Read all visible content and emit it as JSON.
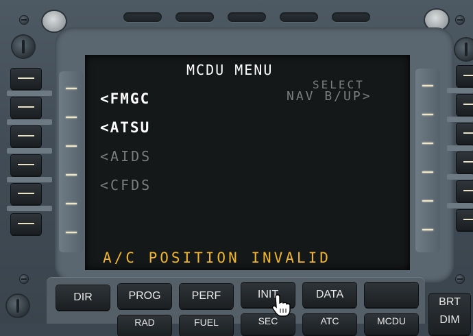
{
  "mcdu": {
    "title": "MCDU MENU",
    "right_label_1": "SELECT",
    "right_value_1": "NAV B/UP>",
    "left_items": [
      {
        "label": "<FMGC",
        "active": true
      },
      {
        "label": "<ATSU",
        "active": true
      },
      {
        "label": "<AIDS",
        "active": false
      },
      {
        "label": "<CFDS",
        "active": false
      }
    ],
    "scratchpad": "A/C POSITION INVALID"
  },
  "keys_row1": [
    "DIR",
    "PROG",
    "PERF",
    "INIT",
    "DATA",
    ""
  ],
  "keys_row2": [
    "RAD",
    "FUEL",
    "SEC",
    "ATC",
    "MCDU"
  ],
  "right_key": "BRT",
  "right_key_sub": "DIM",
  "colors": {
    "active_text": "#ffffff",
    "inactive_text": "#7b7e80",
    "scratchpad_text": "#f2b62c",
    "screen_bg": "#151819"
  },
  "icons": {
    "cursor": "hand-pointer-icon"
  }
}
